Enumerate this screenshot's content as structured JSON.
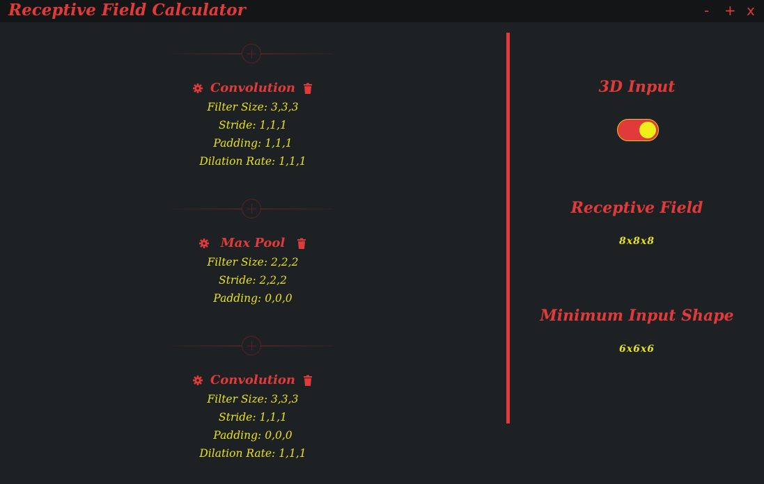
{
  "app": {
    "title": "Receptive Field Calculator",
    "controls": {
      "minimize": "-",
      "maximize": "+",
      "close": "x"
    }
  },
  "layers": [
    {
      "name": "Convolution",
      "params": [
        "Filter Size: 3,3,3",
        "Stride: 1,1,1",
        "Padding: 1,1,1",
        "Dilation Rate: 1,1,1"
      ]
    },
    {
      "name": "Max Pool",
      "params": [
        "Filter Size: 2,2,2",
        "Stride: 2,2,2",
        "Padding: 0,0,0"
      ]
    },
    {
      "name": "Convolution",
      "params": [
        "Filter Size: 3,3,3",
        "Stride: 1,1,1",
        "Padding: 0,0,0",
        "Dilation Rate: 1,1,1"
      ]
    }
  ],
  "right": {
    "input_mode_label": "3D Input",
    "input_mode_on": true,
    "receptive_field_label": "Receptive Field",
    "receptive_field_value": "8x8x8",
    "min_input_label": "Minimum Input Shape",
    "min_input_value": "6x6x6"
  },
  "colors": {
    "accent": "#e03a3a",
    "text": "#e8e21a",
    "background": "#1e2124"
  },
  "icons": {
    "add": "plus-circle-icon",
    "settings": "gear-icon",
    "delete": "trash-icon"
  }
}
